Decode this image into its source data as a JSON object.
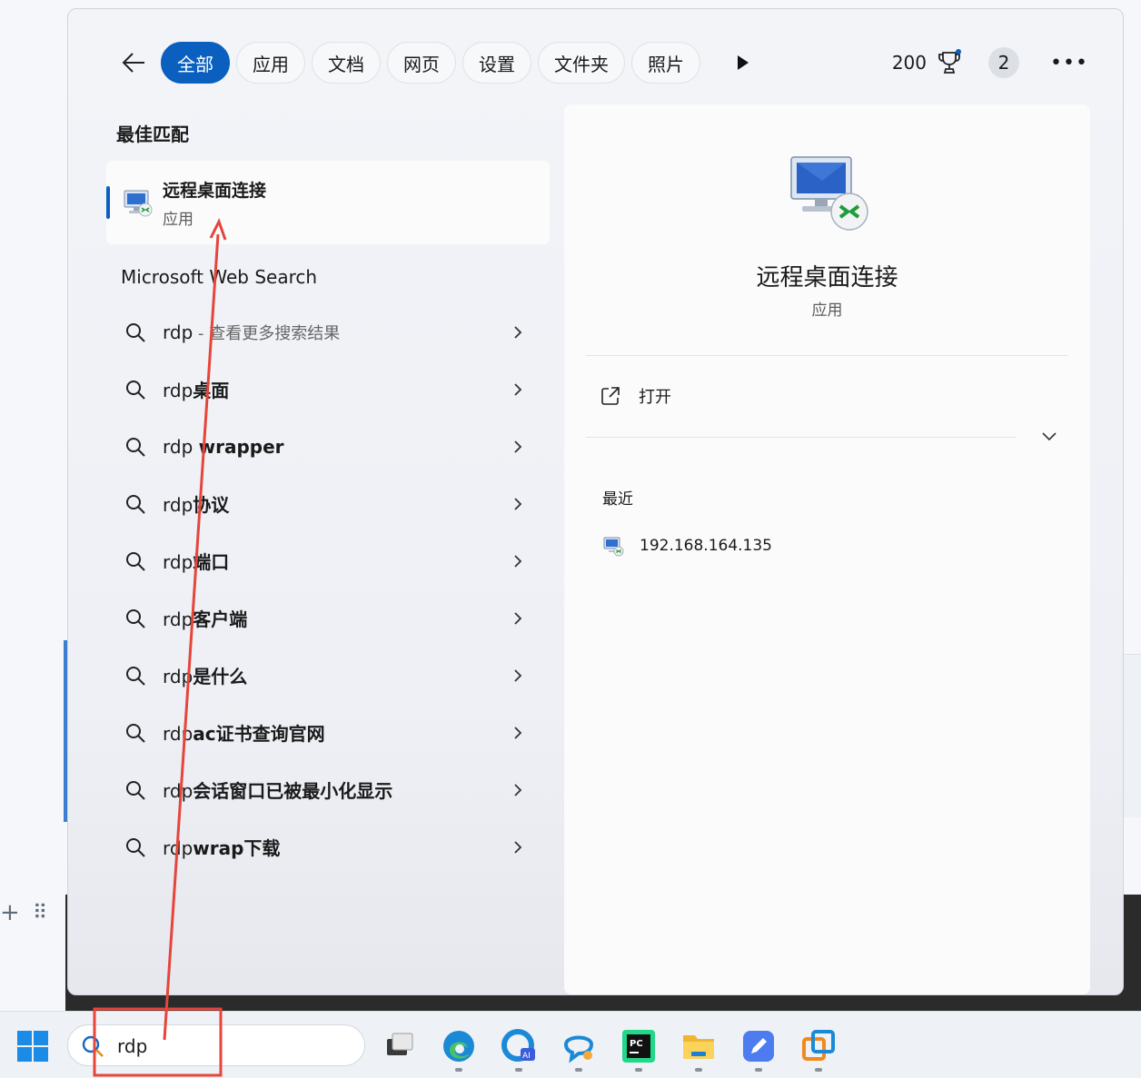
{
  "filters": {
    "back_icon": "arrow-left-icon",
    "tabs": [
      "全部",
      "应用",
      "文档",
      "网页",
      "设置",
      "文件夹",
      "照片"
    ],
    "active_index": 0,
    "more_filters_icon": "play-icon"
  },
  "header": {
    "points": "200",
    "rewards_icon": "trophy-icon",
    "notifications_count": "2",
    "more_icon": "ellipsis-icon"
  },
  "best_match": {
    "section_title": "最佳匹配",
    "app_name": "远程桌面连接",
    "app_type": "应用",
    "icon": "remote-desktop-icon"
  },
  "web_search": {
    "section_title": "Microsoft Web Search",
    "items": [
      {
        "prefix": "rdp",
        "suffix": " - 查看更多搜索结果",
        "muted": true
      },
      {
        "prefix": "rdp",
        "suffix": "桌面",
        "muted": false
      },
      {
        "prefix": "rdp ",
        "suffix": "wrapper",
        "muted": false
      },
      {
        "prefix": "rdp",
        "suffix": "协议",
        "muted": false
      },
      {
        "prefix": "rdp",
        "suffix": "端口",
        "muted": false
      },
      {
        "prefix": "rdp",
        "suffix": "客户端",
        "muted": false
      },
      {
        "prefix": "rdp",
        "suffix": "是什么",
        "muted": false
      },
      {
        "prefix": "rdp",
        "suffix": "ac证书查询官网",
        "muted": false
      },
      {
        "prefix": "rdp",
        "suffix": "会话窗口已被最小化显示",
        "muted": false
      },
      {
        "prefix": "rdp",
        "suffix": "wrap下载",
        "muted": false
      }
    ]
  },
  "detail": {
    "app_name": "远程桌面连接",
    "app_type": "应用",
    "open_label": "打开",
    "recent_title": "最近",
    "recent_items": [
      "192.168.164.135"
    ]
  },
  "taskbar": {
    "search_value": "rdp",
    "apps": [
      "task-view-icon",
      "edge-icon",
      "edge-ai-icon",
      "copilot-chat-icon",
      "pycharm-icon",
      "file-explorer-icon",
      "notes-app-icon",
      "vmware-icon"
    ]
  },
  "colors": {
    "accent": "#0a5fbf",
    "annotation_red": "#e5453b"
  }
}
